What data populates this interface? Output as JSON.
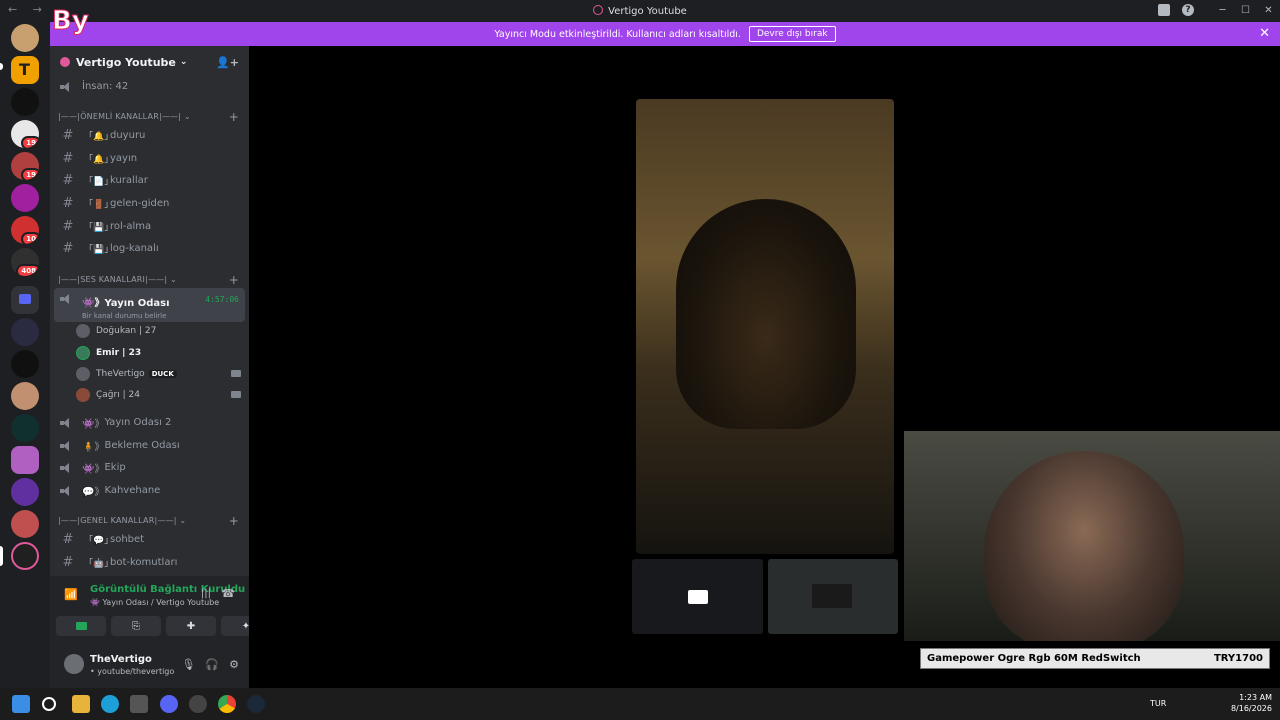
{
  "window": {
    "title": "Vertigo Youtube",
    "nav_label": "← →"
  },
  "logo_text": "By",
  "banner": {
    "text": "Yayıncı Modu etkinleştirildi. Kullanıcı adları kısaltıldı.",
    "button": "Devre dışı bırak",
    "close": "✕"
  },
  "servers": [
    {
      "badge": ""
    },
    {
      "badge": ""
    },
    {
      "badge": ""
    },
    {
      "badge": "19"
    },
    {
      "badge": "19"
    },
    {
      "badge": ""
    },
    {
      "badge": "10"
    },
    {
      "badge": "408"
    }
  ],
  "server": {
    "name": "Vertigo Youtube",
    "member_count": "İnsan: 42"
  },
  "categories": {
    "important": "|——|ÖNEMLİ KANALLAR|——|",
    "voice": "|——|SES KANALLARI|——|",
    "general": "|——|GENEL KANALLAR|——|"
  },
  "text_channels": [
    {
      "emoji": "「🔔」",
      "name": "duyuru"
    },
    {
      "emoji": "「🔔」",
      "name": "yayın"
    },
    {
      "emoji": "「📄」",
      "name": "kurallar"
    },
    {
      "emoji": "「🚪」",
      "name": "gelen-giden"
    },
    {
      "emoji": "「💾」",
      "name": "rol-alma"
    },
    {
      "emoji": "「💾」",
      "name": "log-kanalı"
    }
  ],
  "active_voice": {
    "prefix": "👾》",
    "name": "Yayın Odası",
    "timer": "4:57:06",
    "status": "Bir kanal durumu belirle"
  },
  "voice_users": [
    {
      "name": "Doğukan | 27"
    },
    {
      "name": "Emir | 23"
    },
    {
      "name": "TheVertigo",
      "tag": "DUCK"
    },
    {
      "name": "Çağrı | 24"
    }
  ],
  "voice_channels": [
    {
      "prefix": "👾》",
      "name": "Yayın Odası 2"
    },
    {
      "prefix": "🧍》",
      "name": "Bekleme Odası"
    },
    {
      "prefix": "👾》",
      "name": "Ekip"
    },
    {
      "prefix": "💬》",
      "name": "Kahvehane"
    }
  ],
  "general_channels": [
    {
      "emoji": "「💬」",
      "name": "sohbet"
    },
    {
      "emoji": "「🤖」",
      "name": "bot-komutları"
    }
  ],
  "voice_panel": {
    "status": "Görüntülü Bağlantı Kuruldu",
    "location": "👾 Yayın Odası / Vertigo Youtube"
  },
  "user": {
    "name": "TheVertigo",
    "status": "• youtube/thevertigo"
  },
  "ticker": {
    "product": "Gamepower Ogre Rgb 60M RedSwitch",
    "price": "TRY1700"
  },
  "taskbar": {
    "lang": "TUR",
    "time": "1:23 AM",
    "date": "8/16/2026"
  }
}
